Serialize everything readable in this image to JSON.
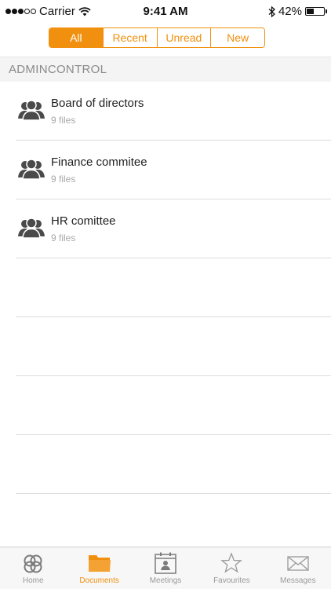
{
  "status_bar": {
    "carrier": "Carrier",
    "time": "9:41 AM",
    "battery": "42%",
    "battery_level": 0.42
  },
  "filters": {
    "tabs": [
      "All",
      "Recent",
      "Unread",
      "New"
    ],
    "selected": "All"
  },
  "section": {
    "title": "ADMINCONTROL"
  },
  "items": [
    {
      "title": "Board of directors",
      "subtitle": "9 files",
      "icon": "group-icon"
    },
    {
      "title": "Finance commitee",
      "subtitle": "9 files",
      "icon": "group-icon"
    },
    {
      "title": "HR comittee",
      "subtitle": "9 files",
      "icon": "group-icon"
    }
  ],
  "tab_bar": {
    "tabs": [
      {
        "label": "Home",
        "icon": "home-rings-icon"
      },
      {
        "label": "Documents",
        "icon": "folder-icon"
      },
      {
        "label": "Meetings",
        "icon": "calendar-icon"
      },
      {
        "label": "Favourites",
        "icon": "star-icon"
      },
      {
        "label": "Messages",
        "icon": "envelope-icon"
      }
    ],
    "selected": "Documents"
  },
  "colors": {
    "accent": "#f0900e",
    "inactive": "#9a9a9a"
  }
}
